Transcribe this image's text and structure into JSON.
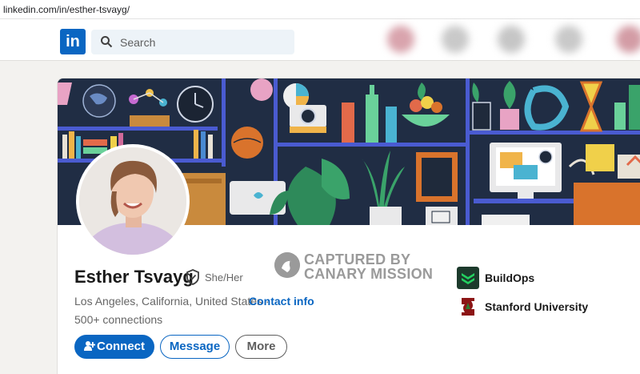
{
  "browser": {
    "url": "linkedin.com/in/esther-tsvayg/"
  },
  "nav": {
    "search_placeholder": "Search",
    "logo_text": "in"
  },
  "profile": {
    "name": "Esther Tsvayg",
    "pronouns": "She/Her",
    "location": "Los Angeles, California, United States · ",
    "contact_info": "Contact info",
    "connections": "500+ connections"
  },
  "actions": {
    "connect": "Connect",
    "message": "Message",
    "more": "More"
  },
  "watermark": {
    "line1": "CAPTURED BY",
    "line2": "CANARY MISSION"
  },
  "experience": [
    {
      "label": "BuildOps",
      "logo_color": "#1c3a2c",
      "accent": "#23d160"
    },
    {
      "label": "Stanford University",
      "logo_color": "#ffffff",
      "accent": "#8c1515"
    }
  ],
  "colors": {
    "brand": "#0a66c2",
    "banner_bg": "#1f2a3b",
    "shelf": "#4a5bd1"
  }
}
